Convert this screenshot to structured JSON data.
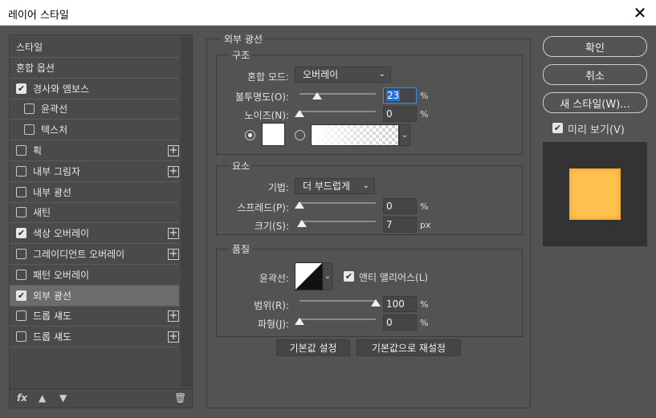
{
  "window": {
    "title": "레이어 스타일"
  },
  "styles_list": {
    "items": [
      {
        "label": "스타일",
        "checkbox": false,
        "checked": false,
        "plus": false,
        "indent": false,
        "selected": false
      },
      {
        "label": "혼합 옵션",
        "checkbox": false,
        "checked": false,
        "plus": false,
        "indent": false,
        "selected": false
      },
      {
        "label": "경사와 엠보스",
        "checkbox": true,
        "checked": true,
        "plus": false,
        "indent": false,
        "selected": false
      },
      {
        "label": "윤곽선",
        "checkbox": true,
        "checked": false,
        "plus": false,
        "indent": true,
        "selected": false
      },
      {
        "label": "텍스처",
        "checkbox": true,
        "checked": false,
        "plus": false,
        "indent": true,
        "selected": false
      },
      {
        "label": "획",
        "checkbox": true,
        "checked": false,
        "plus": true,
        "indent": false,
        "selected": false
      },
      {
        "label": "내부 그림자",
        "checkbox": true,
        "checked": false,
        "plus": true,
        "indent": false,
        "selected": false
      },
      {
        "label": "내부 광선",
        "checkbox": true,
        "checked": false,
        "plus": false,
        "indent": false,
        "selected": false
      },
      {
        "label": "새틴",
        "checkbox": true,
        "checked": false,
        "plus": false,
        "indent": false,
        "selected": false
      },
      {
        "label": "색상 오버레이",
        "checkbox": true,
        "checked": true,
        "plus": true,
        "indent": false,
        "selected": false
      },
      {
        "label": "그레이디언트 오버레이",
        "checkbox": true,
        "checked": false,
        "plus": true,
        "indent": false,
        "selected": false
      },
      {
        "label": "패턴 오버레이",
        "checkbox": true,
        "checked": false,
        "plus": false,
        "indent": false,
        "selected": false
      },
      {
        "label": "외부 광선",
        "checkbox": true,
        "checked": true,
        "plus": false,
        "indent": false,
        "selected": true
      },
      {
        "label": "드롭 섀도",
        "checkbox": true,
        "checked": false,
        "plus": true,
        "indent": false,
        "selected": false
      },
      {
        "label": "드롭 섀도",
        "checkbox": true,
        "checked": false,
        "plus": true,
        "indent": false,
        "selected": false
      }
    ],
    "bottom": {
      "fx_label": "fx"
    }
  },
  "outer_glow": {
    "title": "외부 광선",
    "structure": {
      "title": "구조",
      "blend_mode_label": "혼합 모드:",
      "blend_mode_value": "오버레이",
      "opacity_label": "불투명도(O):",
      "opacity_value": "23",
      "opacity_level": 23,
      "noise_label": "노이즈(N):",
      "noise_value": "0",
      "noise_level": 0,
      "unit_percent": "%"
    },
    "elements": {
      "title": "요소",
      "technique_label": "기법:",
      "technique_value": "더 부드럽게",
      "spread_label": "스프레드(P):",
      "spread_value": "0",
      "spread_level": 0,
      "size_label": "크기(S):",
      "size_value": "7",
      "size_level": 2.8,
      "unit_px": "px"
    },
    "quality": {
      "title": "품질",
      "contour_label": "윤곽선:",
      "antialias_label": "앤티 앨리어스(L)",
      "antialias_checked": true,
      "range_label": "범위(R):",
      "range_value": "100",
      "range_level": 100,
      "jitter_label": "파형(J):",
      "jitter_value": "0",
      "jitter_level": 0
    },
    "buttons": {
      "make_default": "기본값 설정",
      "reset_default": "기본값으로 재설정"
    }
  },
  "right_panel": {
    "ok": "확인",
    "cancel": "취소",
    "new_style": "새 스타일(W)...",
    "preview_label": "미리 보기(V)",
    "preview_checked": true
  },
  "colors": {
    "dialog_bg": "#535353",
    "glow_color": "#ffffff",
    "preview_fill": "#ffc24f",
    "accent": "#2a6fd6"
  }
}
